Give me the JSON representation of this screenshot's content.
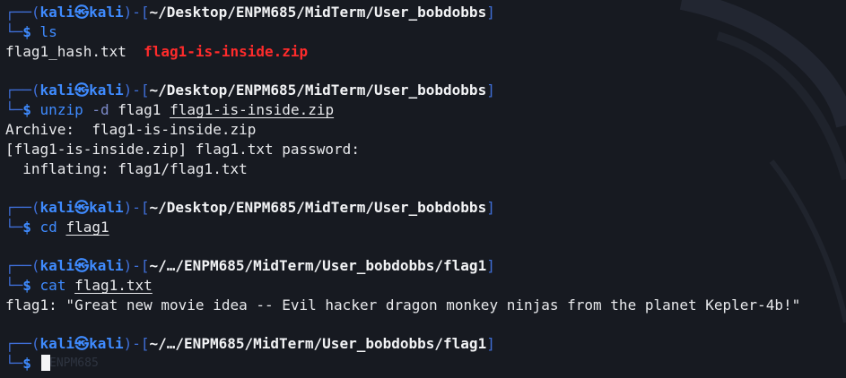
{
  "prompt": {
    "user": "kali",
    "host": "kali",
    "path_full": "~/Desktop/ENPM685/MidTerm/User_bobdobbs",
    "path_short": "~/…/ENPM685/MidTerm/User_bobdobbs/flag1"
  },
  "block1": {
    "cmd": "ls",
    "files": [
      "flag1_hash.txt",
      "flag1-is-inside.zip"
    ]
  },
  "block2": {
    "cmd": "unzip",
    "opt": "-d",
    "arg1": "flag1",
    "arg2": "flag1-is-inside.zip",
    "out1": "Archive:  flag1-is-inside.zip",
    "out2": "[flag1-is-inside.zip] flag1.txt password: ",
    "out3": "  inflating: flag1/flag1.txt"
  },
  "block3": {
    "cmd": "cd",
    "arg": "flag1"
  },
  "block4": {
    "cmd": "cat",
    "arg": "flag1.txt",
    "out": "flag1: \"Great new movie idea -- Evil hacker dragon monkey ninjas from the planet Kepler-4b!\""
  },
  "ghost_text": "ENPM685",
  "colors": {
    "background": "#171a21",
    "prompt_blue": "#3f8bff",
    "archive_red": "#ff2b2b",
    "text": "#e8e9ec"
  },
  "icons": {
    "skull": "kali-skull-icon"
  }
}
